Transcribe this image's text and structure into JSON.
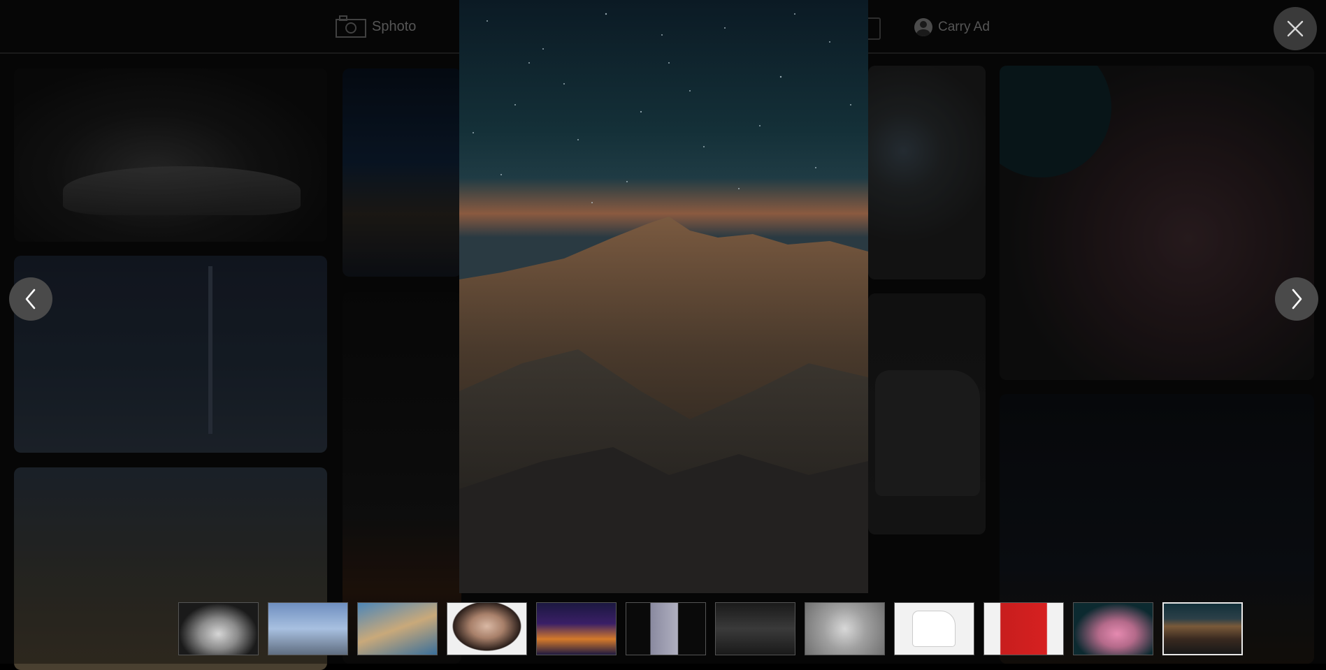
{
  "header": {
    "brand_name": "Sphoto",
    "user_name": "Carry Ad"
  },
  "lightbox": {
    "current_index": 12,
    "total": 12,
    "controls": {
      "close_icon": "close-icon",
      "prev_icon": "chevron-left-icon",
      "next_icon": "chevron-right-icon"
    },
    "thumbnails": [
      {
        "subject": "sports-car"
      },
      {
        "subject": "dubai-skyline"
      },
      {
        "subject": "new-york-aerial"
      },
      {
        "subject": "woman-portrait"
      },
      {
        "subject": "city-night"
      },
      {
        "subject": "crowd-concert"
      },
      {
        "subject": "stock-chart"
      },
      {
        "subject": "cat"
      },
      {
        "subject": "sneaker"
      },
      {
        "subject": "man-red-suit"
      },
      {
        "subject": "woman-pink"
      },
      {
        "subject": "mountain-night",
        "selected": true
      }
    ]
  },
  "colors": {
    "overlay": "#000000",
    "button_bg": "#3a3a3a",
    "thumb_active_border": "#e8e8e8"
  }
}
